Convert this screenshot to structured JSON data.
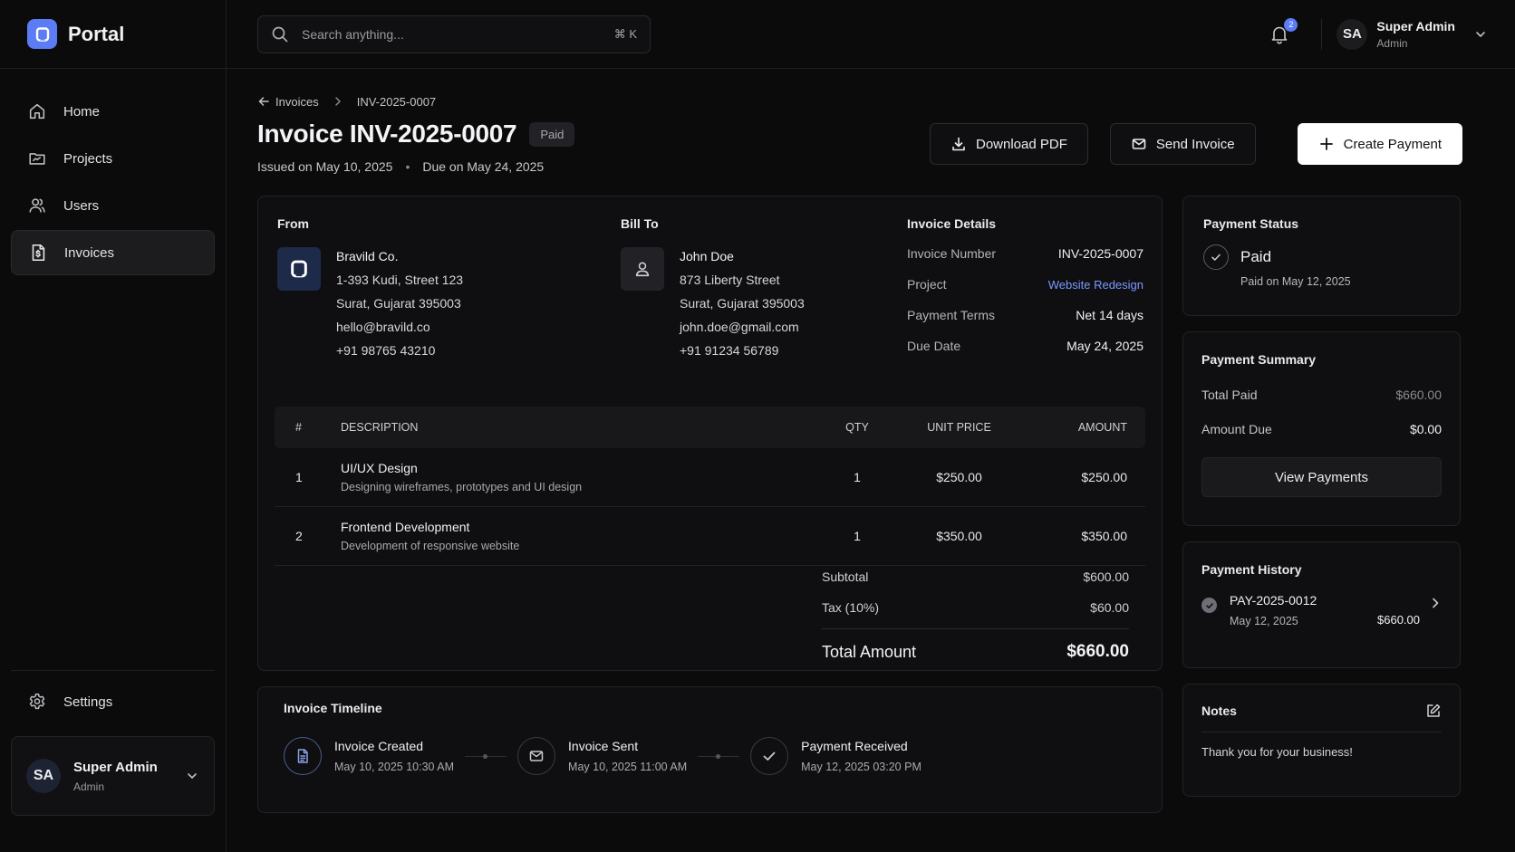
{
  "brand": {
    "name": "Portal"
  },
  "search": {
    "placeholder": "Search anything...",
    "shortcut": "⌘ K"
  },
  "notifications": {
    "count": "2"
  },
  "top_user": {
    "initials": "SA",
    "name": "Super Admin",
    "role": "Admin"
  },
  "sidebar": {
    "items": [
      {
        "label": "Home",
        "icon": "home-icon"
      },
      {
        "label": "Projects",
        "icon": "projects-icon"
      },
      {
        "label": "Users",
        "icon": "users-icon"
      },
      {
        "label": "Invoices",
        "icon": "invoice-icon",
        "active": true
      }
    ],
    "settings_label": "Settings",
    "user": {
      "initials": "SA",
      "name": "Super Admin",
      "role": "Admin"
    }
  },
  "breadcrumb": {
    "parent": "Invoices",
    "current": "INV-2025-0007"
  },
  "invoice": {
    "title": "Invoice INV-2025-0007",
    "status": "Paid",
    "issued": "Issued on May 10, 2025",
    "due": "Due on May 24, 2025"
  },
  "actions": {
    "download": "Download PDF",
    "send": "Send Invoice",
    "create": "Create Payment"
  },
  "from": {
    "label": "From",
    "name": "Bravild Co.",
    "address1": "1-393 Kudi, Street 123",
    "address2": "Surat, Gujarat 395003",
    "email": "hello@bravild.co",
    "phone": "+91 98765 43210"
  },
  "bill_to": {
    "label": "Bill To",
    "name": "John Doe",
    "address1": "873 Liberty Street",
    "address2": "Surat, Gujarat 395003",
    "email": "john.doe@gmail.com",
    "phone": "+91 91234 56789"
  },
  "details": {
    "label": "Invoice Details",
    "rows": [
      {
        "k": "Invoice Number",
        "v": "INV-2025-0007"
      },
      {
        "k": "Project",
        "v": "Website Redesign"
      },
      {
        "k": "Payment Terms",
        "v": "Net 14 days"
      },
      {
        "k": "Due Date",
        "v": "May 24, 2025"
      }
    ]
  },
  "table": {
    "headers": {
      "num": "#",
      "desc": "DESCRIPTION",
      "qty": "QTY",
      "price": "UNIT PRICE",
      "amount": "AMOUNT"
    },
    "rows": [
      {
        "num": "1",
        "title": "UI/UX Design",
        "sub": "Designing wireframes, prototypes and UI design",
        "qty": "1",
        "price": "$250.00",
        "amount": "$250.00"
      },
      {
        "num": "2",
        "title": "Frontend Development",
        "sub": "Development of responsive website",
        "qty": "1",
        "price": "$350.00",
        "amount": "$350.00"
      }
    ]
  },
  "totals": {
    "subtotal_label": "Subtotal",
    "subtotal": "$600.00",
    "tax_label": "Tax (10%)",
    "tax": "$60.00",
    "total_label": "Total Amount",
    "total": "$660.00"
  },
  "timeline": {
    "label": "Invoice Timeline",
    "steps": [
      {
        "title": "Invoice Created",
        "time": "May 10, 2025  10:30 AM"
      },
      {
        "title": "Invoice Sent",
        "time": "May 10, 2025  11:00 AM"
      },
      {
        "title": "Payment Received",
        "time": "May 12, 2025  03:20 PM"
      }
    ]
  },
  "payment_status": {
    "label": "Payment Status",
    "status": "Paid",
    "sub": "Paid on May 12, 2025"
  },
  "payment_summary": {
    "label": "Payment Summary",
    "total_paid_label": "Total Paid",
    "total_paid": "$660.00",
    "amount_due_label": "Amount Due",
    "amount_due": "$0.00",
    "view_button": "View Payments"
  },
  "payment_history": {
    "label": "Payment History",
    "items": [
      {
        "id": "PAY-2025-0012",
        "date": "May 12, 2025",
        "amount": "$660.00"
      }
    ]
  },
  "notes": {
    "label": "Notes",
    "text": "Thank you for your business!"
  },
  "colors": {
    "accent": "#5b7cf5",
    "link": "#7b98ff",
    "background": "#0b0b0c",
    "card": "#0f0f11"
  }
}
